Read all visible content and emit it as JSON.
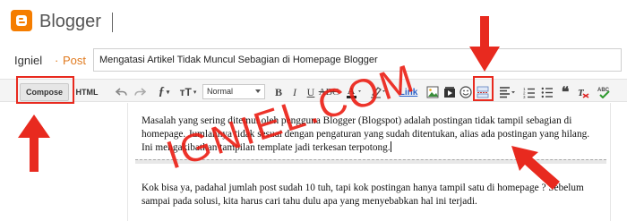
{
  "appbar": {
    "brand": "Blogger",
    "logo_icon": "blogger-logo-icon"
  },
  "title_row": {
    "blog_name": "Igniel",
    "separator": "·",
    "section": "Post",
    "post_title": "Mengatasi Artikel Tidak Muncul Sebagian di Homepage Blogger"
  },
  "toolbar": {
    "compose_label": "Compose",
    "html_label": "HTML",
    "format_value": "Normal",
    "link_label": "Link",
    "icons": [
      "undo-icon",
      "redo-icon",
      "font-icon",
      "font-size-icon",
      "bold-icon",
      "italic-icon",
      "underline-icon",
      "strikethrough-icon",
      "text-color-icon",
      "highlight-icon",
      "link-icon",
      "image-icon",
      "video-icon",
      "emoji-icon",
      "jump-break-icon",
      "align-icon",
      "numbered-list-icon",
      "bulleted-list-icon",
      "quote-icon",
      "clear-format-icon",
      "spellcheck-icon"
    ]
  },
  "editor": {
    "paragraph1": "Masalah yang sering ditemui oleh pengguna Blogger (Blogspot) adalah postingan tidak tampil sebagian di homepage. Jumlahnya tidak sesuai dengan pengaturan yang sudah ditentukan, alias ada postingan yang hilang. Ini mengakibatkan tampilan template jadi terkesan terpotong.",
    "paragraph2": "Kok bisa ya, padahal jumlah post sudah 10 tuh, tapi kok postingan hanya tampil satu di homepage ? Sebelum sampai pada solusi, kita harus cari tahu dulu apa yang menyebabkan hal ini terjadi."
  },
  "watermark": "IGNIEL.COM",
  "colors": {
    "brand": "#f57d00",
    "accent": "#e07a1f",
    "annotation": "#e82a1f"
  }
}
